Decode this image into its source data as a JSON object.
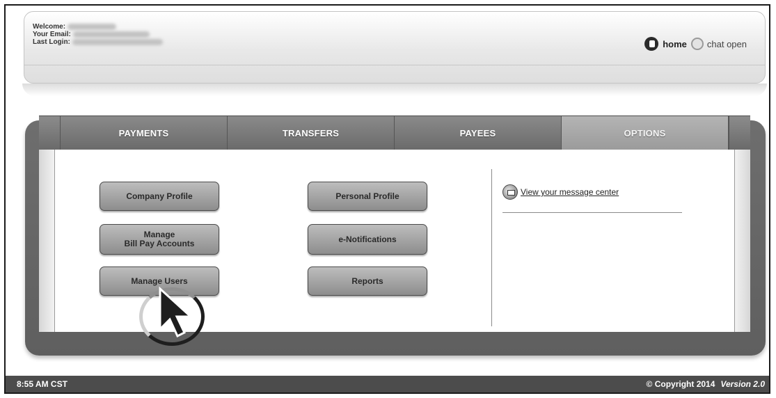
{
  "header": {
    "welcome_label": "Welcome:",
    "email_label": "Your Email:",
    "last_login_label": "Last Login:",
    "home_label": "home",
    "chat_label": "chat open"
  },
  "tabs": [
    {
      "label": "PAYMENTS",
      "active": false
    },
    {
      "label": "TRANSFERS",
      "active": false
    },
    {
      "label": "PAYEES",
      "active": false
    },
    {
      "label": "OPTIONS",
      "active": true
    }
  ],
  "options": {
    "left_buttons": [
      "Company Profile",
      "Manage\nBill Pay Accounts",
      "Manage Users"
    ],
    "middle_buttons": [
      "Personal Profile",
      "e-Notifications",
      "Reports"
    ],
    "message_link": "View your message center"
  },
  "footer": {
    "time": "8:55 AM CST",
    "copyright": "© Copyright 2014",
    "version": "Version 2.0"
  },
  "icons": {
    "home": "home-icon",
    "chat": "chat-icon",
    "message": "message-center-icon",
    "cursor": "mouse-pointer-icon"
  }
}
